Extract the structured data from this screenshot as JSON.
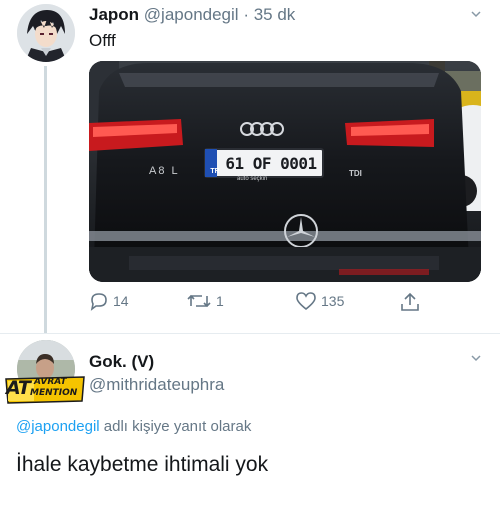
{
  "tweet": {
    "author_name": "Japon",
    "handle": "@japondegil",
    "separator": "·",
    "time": "35 dk",
    "text": "Offf",
    "media": {
      "plate_prefix": "TR",
      "plate": "61 OF 0001",
      "dealer": "auto seçkin",
      "model_badge": "A8 L",
      "trim_badge": "TDI"
    },
    "actions": {
      "replies": "14",
      "retweets": "1",
      "likes": "135"
    }
  },
  "reply": {
    "author_name": "Gok. (V)",
    "handle": "@mithridateuphra",
    "badge": {
      "line1": "AVRAT",
      "line2": "MENTION",
      "prefix": "AT"
    },
    "replying_to_handle": "@japondegil",
    "replying_to_suffix": " adlı kişiye yanıt olarak",
    "text": "İhale kaybetme ihtimali yok"
  },
  "colors": {
    "link": "#1da1f2",
    "muted": "#657786",
    "text": "#14171a"
  }
}
